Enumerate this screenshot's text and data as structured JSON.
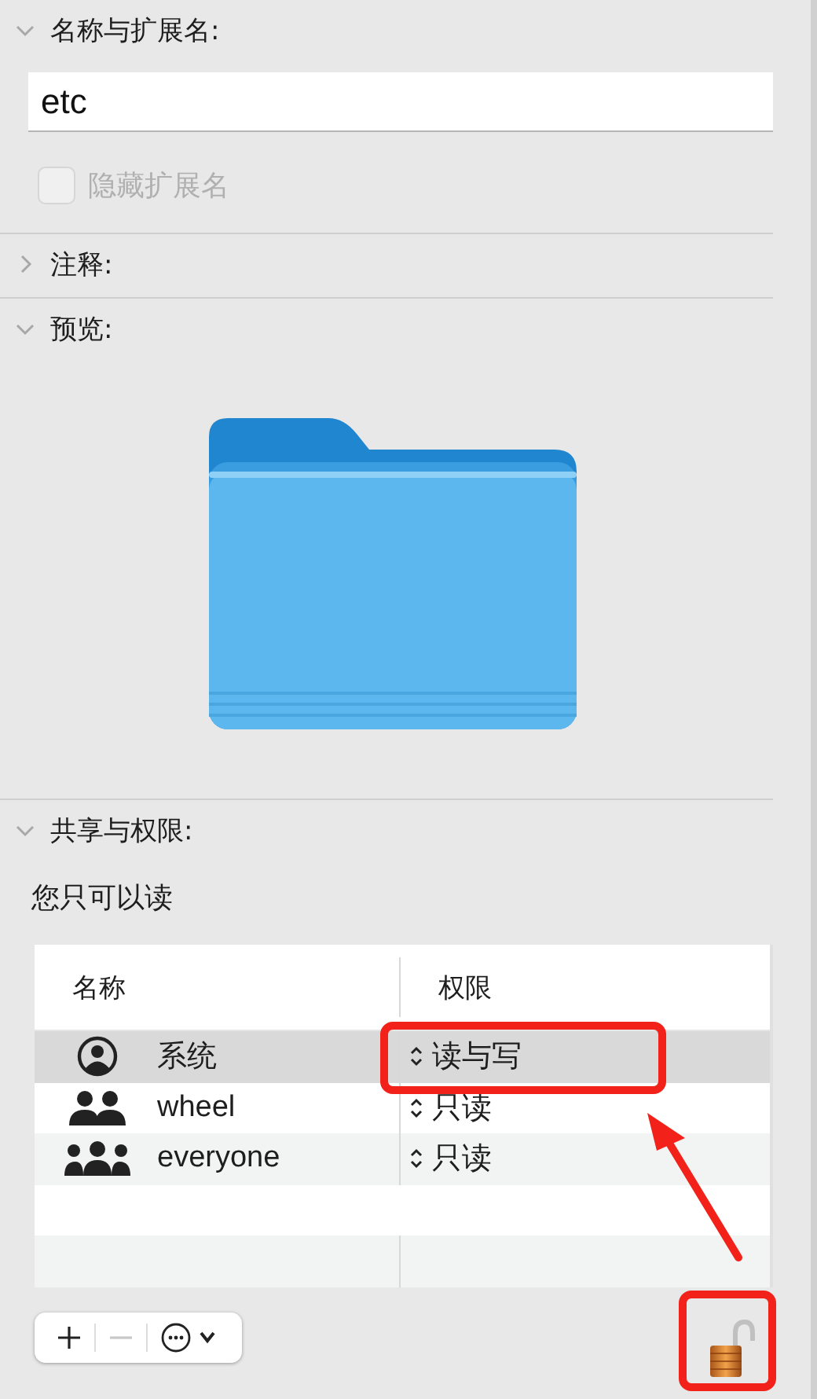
{
  "name_section": {
    "title": "名称与扩展名:",
    "expanded": true,
    "value": "etc",
    "hide_extension": {
      "label": "隐藏扩展名",
      "checked": false,
      "disabled": true
    }
  },
  "comments_section": {
    "title": "注释:",
    "expanded": false
  },
  "preview_section": {
    "title": "预览:",
    "expanded": true,
    "kind": "folder"
  },
  "sharing_section": {
    "title": "共享与权限:",
    "expanded": true,
    "note": "您只可以读",
    "table": {
      "columns": [
        "名称",
        "权限"
      ],
      "rows": [
        {
          "kind": "user",
          "name": "系统",
          "permission": "读与写",
          "selected": true
        },
        {
          "kind": "group",
          "name": "wheel",
          "permission": "只读",
          "selected": false
        },
        {
          "kind": "everyone",
          "name": "everyone",
          "permission": "只读",
          "selected": false
        }
      ]
    },
    "toolbar": [
      {
        "kind": "add",
        "disabled": false
      },
      {
        "kind": "remove",
        "disabled": true
      },
      {
        "kind": "action",
        "disabled": false
      }
    ],
    "lock": {
      "locked": false
    }
  }
}
